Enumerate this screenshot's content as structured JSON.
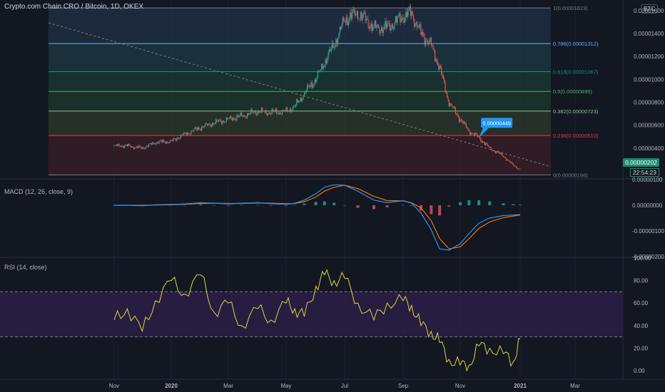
{
  "header": {
    "title": "Crypto.com Chain CRO / Bitcoin, 1D, OKEX",
    "currency": "BTC"
  },
  "price_panel": {
    "last_price": "0.00000202",
    "countdown": "22:54:23",
    "callout": "0.00000449"
  },
  "macd_panel": {
    "label": "MACD (12, 26, close, 9)"
  },
  "rsi_panel": {
    "label": "RSI (14, close)"
  },
  "colors": {
    "background": "#131722",
    "candle_up": "#26a69a",
    "candle_down": "#ef5350",
    "macd_line": "#2196f3",
    "signal_line": "#ff6d00",
    "rsi_line": "#d8d63f",
    "rsi_band": "#2a1e44",
    "fib_0": "#787b86",
    "fib_0236": "#f23645",
    "fib_0382": "#81c784",
    "fib_05": "#4caf50",
    "fib_0618": "#089981",
    "fib_0786": "#64b5f6",
    "fib_1": "#787b86",
    "badge": "#1b8a6b"
  },
  "chart_data": [
    {
      "type": "line",
      "title": "Crypto.com Chain CRO / Bitcoin, 1D, OKEX",
      "x_ticks": [
        "Nov",
        "2020",
        "Mar",
        "May",
        "Jul",
        "Sep",
        "Nov",
        "2021",
        "Mar"
      ],
      "ylim": [
        1.5e-06,
        1.68e-05
      ],
      "y_ticks": [
        "0.00001600",
        "0.00001400",
        "0.00001200",
        "0.00001000",
        "0.00000800",
        "0.00000600",
        "0.00000400"
      ],
      "fib_levels": [
        {
          "ratio": "1",
          "value": 1.623e-05,
          "label": "1(0.00001623)"
        },
        {
          "ratio": "0.786",
          "value": 1.312e-05,
          "label": "0.786(0.00001312)"
        },
        {
          "ratio": "0.618",
          "value": 1.067e-05,
          "label": "0.618(0.00001067)"
        },
        {
          "ratio": "0.5",
          "value": 8.95e-06,
          "label": "0.5(0.00000895)"
        },
        {
          "ratio": "0.382",
          "value": 7.23e-06,
          "label": "0.382(0.00000723)"
        },
        {
          "ratio": "0.236",
          "value": 5.1e-06,
          "label": "0.236(0.00000510)"
        },
        {
          "ratio": "0",
          "value": 1.66e-06,
          "label": "0(0.00000166)"
        }
      ],
      "series": [
        {
          "x": [
            "2019-11-01",
            "2019-11-15",
            "2019-12-01",
            "2019-12-15",
            "2020-01-01",
            "2020-01-15",
            "2020-02-01",
            "2020-02-15",
            "2020-03-01",
            "2020-03-15",
            "2020-04-01",
            "2020-04-15",
            "2020-05-01",
            "2020-05-10",
            "2020-05-20",
            "2020-06-01",
            "2020-06-10",
            "2020-06-20",
            "2020-07-01",
            "2020-07-15",
            "2020-08-01",
            "2020-08-15",
            "2020-09-01",
            "2020-09-10",
            "2020-09-20",
            "2020-10-01",
            "2020-10-10",
            "2020-10-20",
            "2020-11-01",
            "2020-11-10",
            "2020-11-20",
            "2020-12-01",
            "2020-12-15",
            "2020-12-25",
            "2021-01-01"
          ],
          "values": [
            4.2e-06,
            4.2e-06,
            4e-06,
            4.5e-06,
            4.6e-06,
            5.2e-06,
            5.8e-06,
            6.2e-06,
            6.5e-06,
            6.8e-06,
            7.2e-06,
            7.1e-06,
            7.2e-06,
            7.6e-06,
            8.8e-06,
            1e-05,
            1.15e-05,
            1.3e-05,
            1.52e-05,
            1.58e-05,
            1.45e-05,
            1.45e-05,
            1.55e-05,
            1.58e-05,
            1.4e-05,
            1.3e-05,
            1.1e-05,
            8e-06,
            6.5e-06,
            5.5e-06,
            4.9e-06,
            4e-06,
            3.3e-06,
            2.5e-06,
            2.1e-06
          ]
        }
      ]
    },
    {
      "type": "line",
      "title": "MACD (12, 26, close, 9)",
      "x_ticks": [
        "Nov",
        "2020",
        "Mar",
        "May",
        "Jul",
        "Sep",
        "Nov",
        "2021",
        "Mar"
      ],
      "ylim": [
        -2e-06,
        1e-06
      ],
      "y_ticks": [
        "0.00000100",
        "0.00000000",
        "-0.00000100",
        "-0.00000200"
      ],
      "series": [
        {
          "name": "MACD",
          "values": [
            0.0,
            0.0,
            -2e-08,
            2e-08,
            3e-08,
            5e-08,
            1e-07,
            8e-08,
            5e-08,
            8e-08,
            1e-07,
            6e-08,
            4e-08,
            8e-08,
            2e-07,
            4.5e-07,
            7e-07,
            8e-07,
            7.8e-07,
            5.5e-07,
            2e-07,
            1e-07,
            1.8e-07,
            8e-08,
            -3e-07,
            -9.5e-07,
            -1.7e-06,
            -1.75e-06,
            -1.5e-06,
            -1.1e-06,
            -7e-07,
            -5e-07,
            -4e-07,
            -3.8e-07,
            -3.6e-07
          ]
        },
        {
          "name": "Signal",
          "values": [
            0.0,
            0.0,
            0.0,
            1e-08,
            2e-08,
            4e-08,
            7e-08,
            8e-08,
            7e-08,
            7e-08,
            9e-08,
            8e-08,
            6e-08,
            7e-08,
            1.4e-07,
            3.2e-07,
            5.5e-07,
            7e-07,
            7.8e-07,
            6.5e-07,
            3.5e-07,
            1.8e-07,
            1.7e-07,
            1e-07,
            -1e-07,
            -6e-07,
            -1.3e-06,
            -1.7e-06,
            -1.62e-06,
            -1.3e-06,
            -9e-07,
            -6.5e-07,
            -4.8e-07,
            -4.2e-07,
            -3.8e-07
          ]
        }
      ]
    },
    {
      "type": "line",
      "title": "RSI (14, close)",
      "x_ticks": [
        "Nov",
        "2020",
        "Mar",
        "May",
        "Jul",
        "Sep",
        "Nov",
        "2021",
        "Mar"
      ],
      "ylim": [
        -5,
        100
      ],
      "y_ticks": [
        "100.00",
        "80.00",
        "60.00",
        "40.00",
        "20.00",
        "0.00"
      ],
      "bands": [
        30,
        70
      ],
      "series": [
        {
          "values": [
            45,
            55,
            35,
            62,
            80,
            68,
            85,
            52,
            60,
            40,
            55,
            45,
            60,
            55,
            48,
            75,
            85,
            80,
            82,
            60,
            45,
            60,
            62,
            58,
            40,
            35,
            25,
            10,
            5,
            5,
            22,
            20,
            15,
            8,
            28
          ]
        }
      ]
    }
  ]
}
